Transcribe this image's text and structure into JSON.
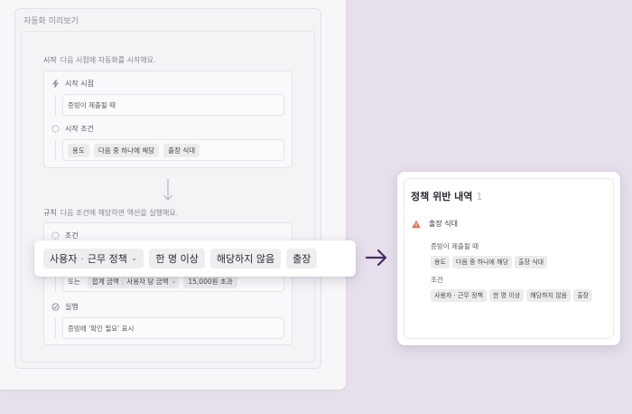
{
  "preview": {
    "title": "자동화 미리보기",
    "start": {
      "label": "시작",
      "desc": "다음 시점에 자동화를 시작해요.",
      "trigger_label": "시작 시점",
      "trigger_value": "증빙이 제출될 때",
      "condition_label": "시작 조건",
      "condition_chips": [
        "용도",
        "다음 중 하나에 해당",
        "출장 식대"
      ]
    },
    "rule": {
      "label": "규칙",
      "desc": "다음 조건에 해당하면 액션을 실행해요.",
      "condition_label": "조건",
      "or_label": "또는",
      "or_chips": [
        "합계 금액",
        "사용자 당 금액",
        "15,000원 초과"
      ],
      "action_label": "실행",
      "action_value": "증빙에 '확인 필요' 표시"
    }
  },
  "overlay": {
    "chip1_a": "사용자",
    "chip1_sep": "·",
    "chip1_b": "근무 정책",
    "chip2": "한 명 이상",
    "chip3": "해당하지 않음",
    "chip4": "출장"
  },
  "policy": {
    "title": "정책 위반 내역",
    "count": "1",
    "violation_title": "출장 식대",
    "trigger_text": "증빙이 제출될 때",
    "trigger_chips": [
      "용도",
      "다음 중 하나에 해당",
      "출장 식대"
    ],
    "condition_label": "조건",
    "condition_chips": [
      "사용자 · 근무 정책",
      "한 명 이상",
      "해당하지 않음",
      "출장"
    ]
  },
  "colors": {
    "background": "#e7dfeb",
    "arrow": "#4a2a6b",
    "warning": "#e0684b"
  }
}
